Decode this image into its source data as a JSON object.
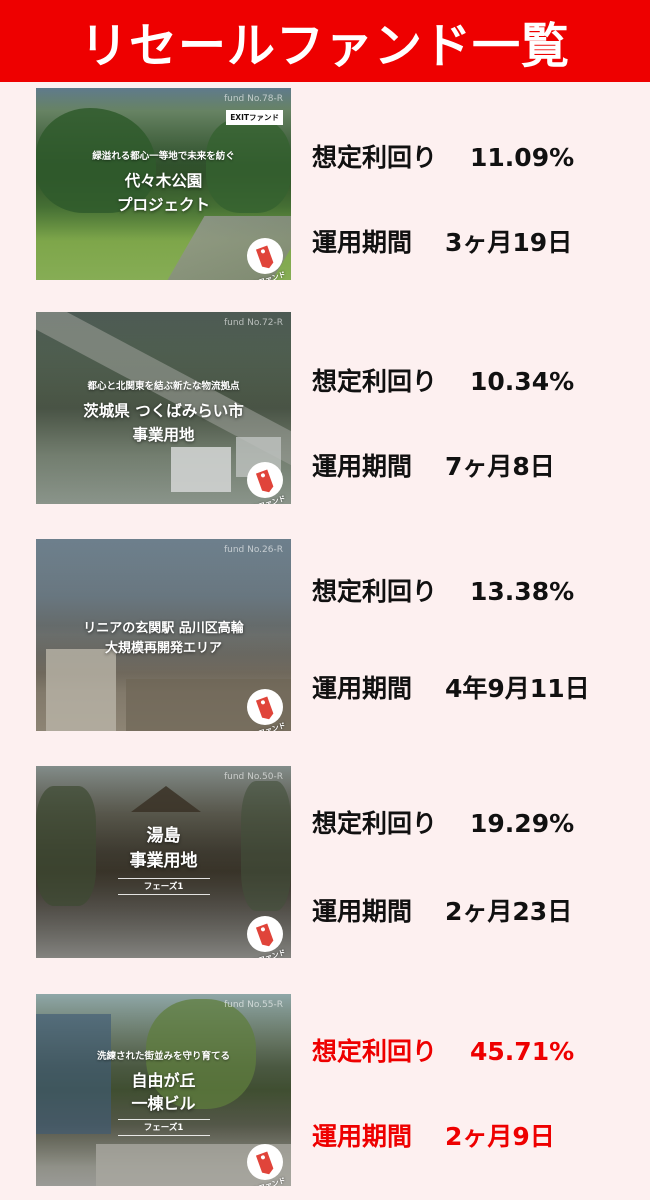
{
  "header": {
    "title": "リセールファンド一覧"
  },
  "labels": {
    "yield": "想定利回り",
    "period": "運用期間"
  },
  "colors": {
    "header_bg": "#ee0000",
    "page_bg": "#fdf0f0",
    "highlight_text": "#ee0000"
  },
  "funds": [
    {
      "fund_no": "fund No.78-R",
      "badge": "EXITファンド",
      "tagline": "緑溢れる都心一等地で未来を紡ぐ",
      "name_lines": [
        "代々木公園",
        "プロジェクト"
      ],
      "phase": "",
      "tag_label": "リセールファンド",
      "tag_icon": "price-tag-icon",
      "yield": "11.09%",
      "period": "3ヶ月19日",
      "highlight": false
    },
    {
      "fund_no": "fund No.72-R",
      "badge": "",
      "tagline": "都心と北関東を結ぶ新たな物流拠点",
      "name_lines": [
        "茨城県 つくばみらい市",
        "事業用地"
      ],
      "phase": "",
      "tag_label": "リセールファンド",
      "tag_icon": "price-tag-icon",
      "yield": "10.34%",
      "period": "7ヶ月8日",
      "highlight": false
    },
    {
      "fund_no": "fund No.26-R",
      "badge": "",
      "tagline": "",
      "name_lines": [
        "リニアの玄関駅 品川区高輪",
        "大規模再開発エリア"
      ],
      "phase": "",
      "tag_label": "リセールファンド",
      "tag_icon": "price-tag-icon",
      "yield": "13.38%",
      "period": "4年9月11日",
      "highlight": false
    },
    {
      "fund_no": "fund No.50-R",
      "badge": "",
      "tagline": "",
      "name_lines": [
        "湯島",
        "事業用地"
      ],
      "phase": "フェーズ1",
      "tag_label": "リセールファンド",
      "tag_icon": "price-tag-icon",
      "yield": "19.29%",
      "period": "2ヶ月23日",
      "highlight": false
    },
    {
      "fund_no": "fund No.55-R",
      "badge": "",
      "tagline": "洗練された街並みを守り育てる",
      "name_lines": [
        "自由が丘",
        "一棟ビル"
      ],
      "phase": "フェーズ1",
      "tag_label": "リセールファンド",
      "tag_icon": "price-tag-icon",
      "yield": "45.71%",
      "period": "2ヶ月9日",
      "highlight": true
    }
  ]
}
